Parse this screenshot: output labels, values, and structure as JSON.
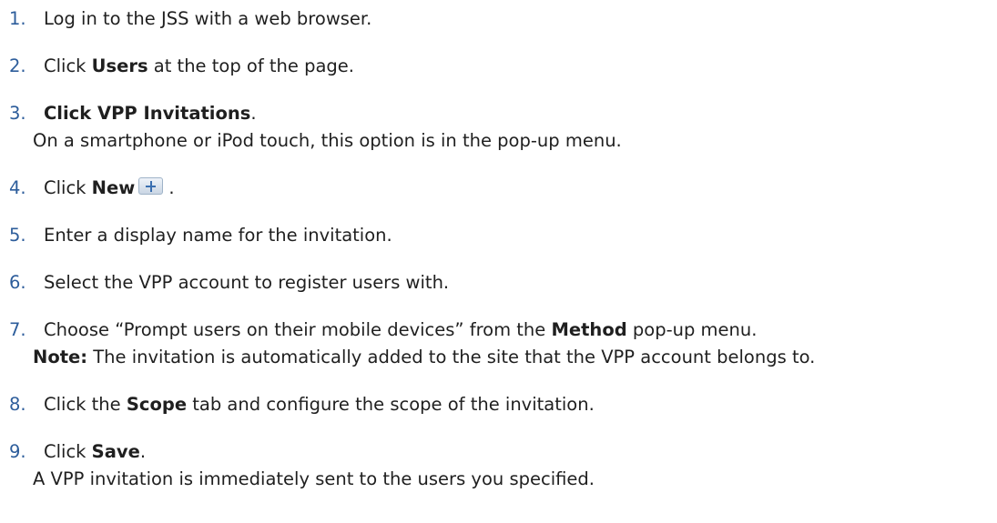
{
  "steps": [
    {
      "number": "1.",
      "text": "Log in to the JSS with a web browser."
    },
    {
      "number": "2.",
      "pre": "Click ",
      "bold": "Users",
      "post": " at the top of the page."
    },
    {
      "number": "3.",
      "bold": "Click VPP Invitations",
      "post": ".",
      "line2": "On a smartphone or iPod touch, this option is in the pop-up menu."
    },
    {
      "number": "4.",
      "pre": "Click ",
      "bold": "New",
      "icon": "plus-button-icon",
      "post": " ."
    },
    {
      "number": "5.",
      "text": "Enter a display name for the invitation."
    },
    {
      "number": "6.",
      "text": "Select the VPP account to register users with."
    },
    {
      "number": "7.",
      "pre": "Choose “Prompt users on their mobile devices” from the ",
      "bold": "Method",
      "post": " pop-up menu.",
      "line2_bold": "Note:",
      "line2": " The invitation is automatically added to the site that the VPP account belongs to."
    },
    {
      "number": "8.",
      "pre": "Click the ",
      "bold": "Scope",
      "post": " tab and configure the scope of the invitation."
    },
    {
      "number": "9.",
      "pre": "Click ",
      "bold": "Save",
      "post": ".",
      "line2": "A VPP invitation is immediately sent to the users you specified."
    }
  ]
}
